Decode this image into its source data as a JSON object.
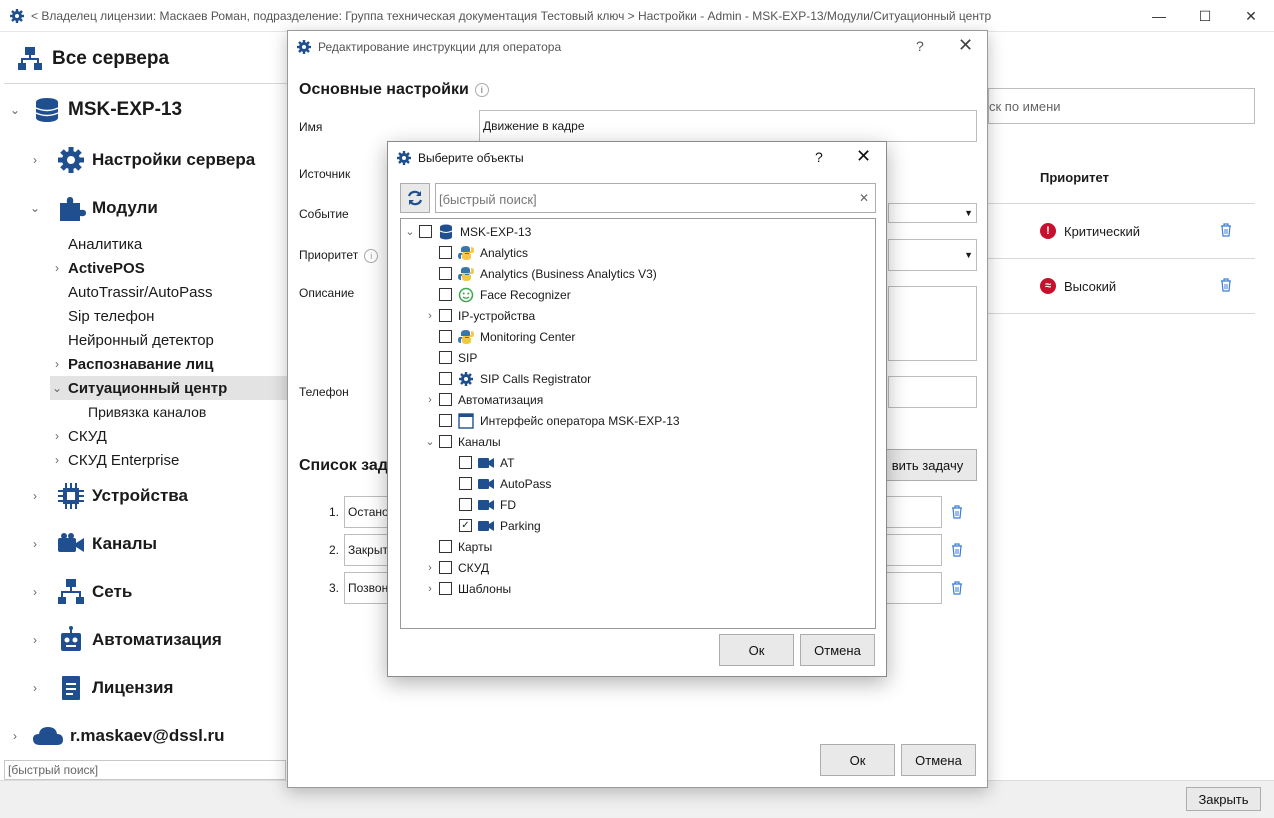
{
  "window": {
    "title": "< Владелец лицензии: Маскаев Роман, подразделение: Группа техническая документация Тестовый ключ > Настройки - Admin - MSK-EXP-13/Модули/Ситуационный центр",
    "minimize": "—",
    "maximize": "☐",
    "close": "✕"
  },
  "left": {
    "header": "Все сервера",
    "server": "MSK-EXP-13",
    "items": {
      "server_settings": "Настройки сервера",
      "modules": "Модули",
      "analytics": "Аналитика",
      "activepos": "ActivePOS",
      "autotrassir": "AutoTrassir/AutoPass",
      "sip": "Sip телефон",
      "neural": "Нейронный детектор",
      "face": "Распознавание лиц",
      "situation": "Ситуационный центр",
      "binding": "Привязка каналов",
      "skud": "СКУД",
      "skud_ent": "СКУД Enterprise",
      "devices": "Устройства",
      "channels": "Каналы",
      "network": "Сеть",
      "automation": "Автоматизация",
      "license": "Лицензия"
    },
    "cloud_user": "r.maskaev@dssl.ru",
    "search_placeholder": "[быстрый поиск]"
  },
  "right": {
    "search_placeholder": "ск по имени",
    "priority_header": "Приоритет",
    "rows": [
      "Критический",
      "Высокий"
    ]
  },
  "status": {
    "close_button": "Закрыть"
  },
  "edit_dialog": {
    "title": "Редактирование инструкции для оператора",
    "help": "?",
    "close": "✕",
    "section_main": "Основные настройки",
    "label_name": "Имя",
    "name_value": "Движение в кадре",
    "label_source": "Источник",
    "label_event": "Событие",
    "label_priority": "Приоритет",
    "label_description": "Описание",
    "label_phone": "Телефон",
    "section_tasks": "Список зад",
    "add_task_button": "вить задачу",
    "tasks": [
      {
        "no": "1.",
        "text": "Останов"
      },
      {
        "no": "2.",
        "text": "Закрыт"
      },
      {
        "no": "3.",
        "text": "Позвон"
      }
    ],
    "ok": "Ок",
    "cancel": "Отмена"
  },
  "select_dialog": {
    "title": "Выберите объекты",
    "help": "?",
    "close": "✕",
    "search_placeholder": "[быстрый поиск]",
    "clear": "✕",
    "tree": [
      {
        "label": "MSK-EXP-13",
        "icon": "database-icon",
        "arrow": "down",
        "checked": false
      },
      {
        "label": "Analytics",
        "icon": "python-icon",
        "arrow": "",
        "checked": false
      },
      {
        "label": "Analytics (Business Analytics V3)",
        "icon": "python-icon",
        "arrow": "",
        "checked": false
      },
      {
        "label": "Face Recognizer",
        "icon": "smile-icon",
        "arrow": "",
        "checked": false
      },
      {
        "label": "IP-устройства",
        "icon": "",
        "arrow": "right",
        "checked": false
      },
      {
        "label": "Monitoring Center",
        "icon": "python-icon",
        "arrow": "",
        "checked": false
      },
      {
        "label": "SIP",
        "icon": "",
        "arrow": "",
        "checked": false
      },
      {
        "label": "SIP Calls Registrator",
        "icon": "gear-icon",
        "arrow": "",
        "checked": false
      },
      {
        "label": "Автоматизация",
        "icon": "",
        "arrow": "right",
        "checked": false
      },
      {
        "label": "Интерфейс оператора MSK-EXP-13",
        "icon": "window-icon",
        "arrow": "",
        "checked": false
      },
      {
        "label": "Каналы",
        "icon": "",
        "arrow": "down",
        "checked": false
      },
      {
        "label": "AT",
        "icon": "camera-icon",
        "arrow": "",
        "checked": false
      },
      {
        "label": "AutoPass",
        "icon": "camera-icon",
        "arrow": "",
        "checked": false
      },
      {
        "label": "FD",
        "icon": "camera-icon",
        "arrow": "",
        "checked": false
      },
      {
        "label": "Parking",
        "icon": "camera-icon",
        "arrow": "",
        "checked": true
      },
      {
        "label": "Карты",
        "icon": "",
        "arrow": "",
        "checked": false
      },
      {
        "label": "СКУД",
        "icon": "",
        "arrow": "right",
        "checked": false
      },
      {
        "label": "Шаблоны",
        "icon": "",
        "arrow": "right",
        "checked": false
      }
    ],
    "ok": "Ок",
    "cancel": "Отмена"
  },
  "colors": {
    "accent": "#1f4f8f",
    "critical": "#c8102e",
    "tree_selected": "#e3e3e3"
  }
}
